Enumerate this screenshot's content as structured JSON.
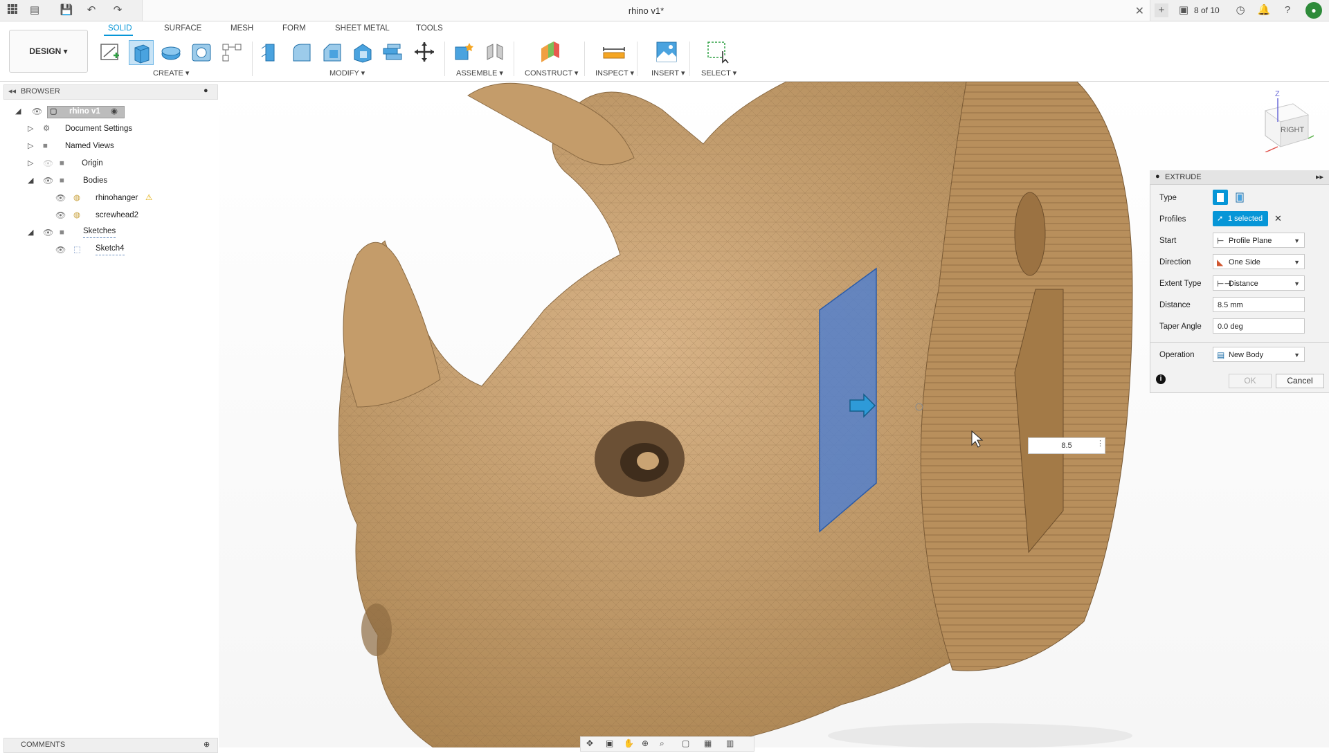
{
  "window": {
    "doc_title": "rhino v1*",
    "tab_count": "8 of 10"
  },
  "toolbar": {
    "design_label": "DESIGN ▾",
    "tabs": [
      "SOLID",
      "SURFACE",
      "MESH",
      "FORM",
      "SHEET METAL",
      "TOOLS"
    ],
    "groups": {
      "create": "CREATE ▾",
      "modify": "MODIFY ▾",
      "assemble": "ASSEMBLE ▾",
      "construct": "CONSTRUCT ▾",
      "inspect": "INSPECT ▾",
      "insert": "INSERT ▾",
      "select": "SELECT ▾"
    }
  },
  "browser": {
    "title": "BROWSER",
    "root": "rhino v1",
    "items": [
      "Document Settings",
      "Named Views",
      "Origin",
      "Bodies",
      "rhinohanger",
      "screwhead2",
      "Sketches",
      "Sketch4"
    ],
    "comments": "COMMENTS"
  },
  "viewcube": {
    "face": "RIGHT",
    "axis_z": "Z"
  },
  "extrude": {
    "title": "EXTRUDE",
    "labels": {
      "type": "Type",
      "profiles": "Profiles",
      "start": "Start",
      "direction": "Direction",
      "extent_type": "Extent Type",
      "distance": "Distance",
      "taper": "Taper Angle",
      "operation": "Operation"
    },
    "profiles_value": "1 selected",
    "start_value": "Profile Plane",
    "direction_value": "One Side",
    "extent_value": "Distance",
    "distance_value": "8.5 mm",
    "taper_value": "0.0 deg",
    "operation_value": "New Body",
    "ok": "OK",
    "cancel": "Cancel"
  },
  "canvas_input": {
    "value": "8.5"
  },
  "colors": {
    "accent": "#0696d7",
    "model": "#c8a272",
    "profile": "#4f7fd0"
  }
}
